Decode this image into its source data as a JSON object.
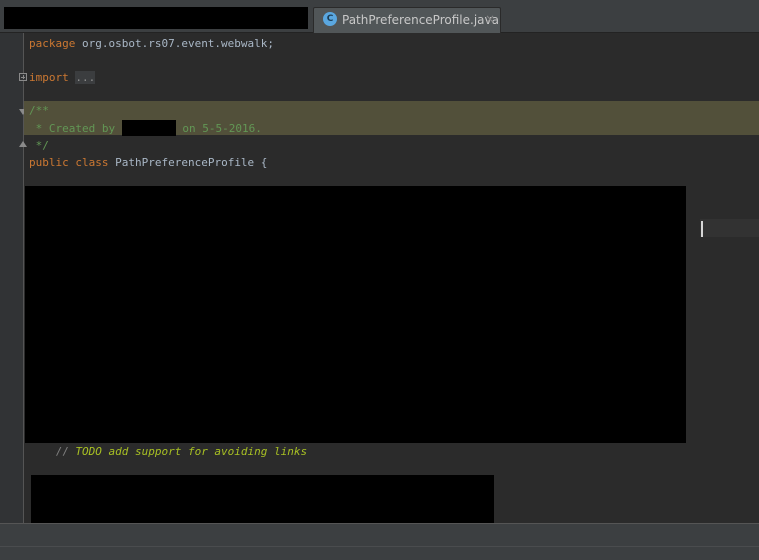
{
  "tab": {
    "icon_letter": "C",
    "title": "PathPreferenceProfile.java",
    "close_glyph": "×"
  },
  "code": {
    "package_kw": "package",
    "package_name": " org.osbot.rs07.event.webwalk;",
    "import_kw": "import",
    "import_folded": "...",
    "doc_open": "/**",
    "doc_created_by": " * Created by ",
    "doc_date": " on 5-5-2016.",
    "doc_close": " */",
    "class_kw": "public class",
    "class_name": " PathPreferenceProfile {",
    "todo_prefix": "    // ",
    "todo_text": "TODO add support for avoiding links"
  },
  "colors": {
    "background": "#2b2b2b",
    "keyword": "#cc7832",
    "doc_comment": "#629755",
    "todo": "#a8c023",
    "plain_text": "#a9b7c6",
    "doc_highlight": "#52503a"
  }
}
